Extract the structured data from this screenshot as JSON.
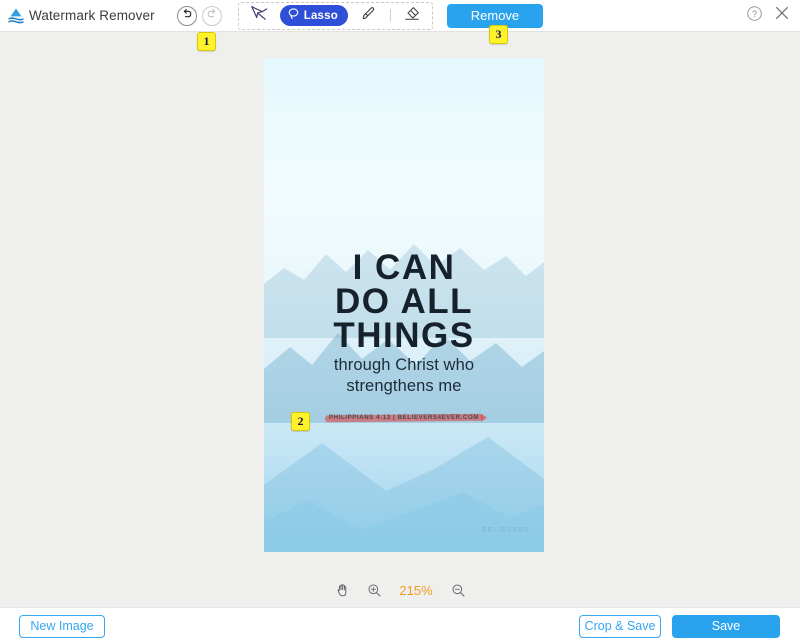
{
  "app": {
    "title": "Watermark Remover",
    "logo_icon": "mountain-wave-logo-icon"
  },
  "toolbar": {
    "undo_icon": "undo-arrow-icon",
    "redo_icon": "redo-arrow-icon",
    "select_tool_icon": "magic-wand-select-icon",
    "lasso_label": "Lasso",
    "lasso_icon": "lasso-loop-icon",
    "brush_icon": "brush-icon",
    "eraser_icon": "eraser-icon",
    "remove_label": "Remove",
    "help_icon": "help-question-icon",
    "close_icon": "close-x-icon",
    "accent_blue": "#2aa3ef",
    "lasso_active_color": "#2f4fd8"
  },
  "badges": [
    {
      "number": "1"
    },
    {
      "number": "2"
    },
    {
      "number": "3"
    }
  ],
  "image": {
    "poster_lines": [
      "I CAN",
      "DO ALL",
      "THINGS"
    ],
    "poster_sub_lines": [
      "through Christ who",
      "strengthens me"
    ],
    "watermark_text": "PHILIPPIANS 4:13 | BELIEVERS4EVER.COM",
    "watermark_stroke_color": "#e04a4a",
    "corner_mark": "BELIEVERS"
  },
  "zoom_controls": {
    "pan_icon": "hand-pan-icon",
    "zoom_in_icon": "zoom-in-icon",
    "zoom_out_icon": "zoom-out-icon",
    "zoom_level": "215%",
    "zoom_level_color": "#f29b1d"
  },
  "footer": {
    "new_image_label": "New Image",
    "crop_save_label": "Crop & Save",
    "save_label": "Save"
  }
}
